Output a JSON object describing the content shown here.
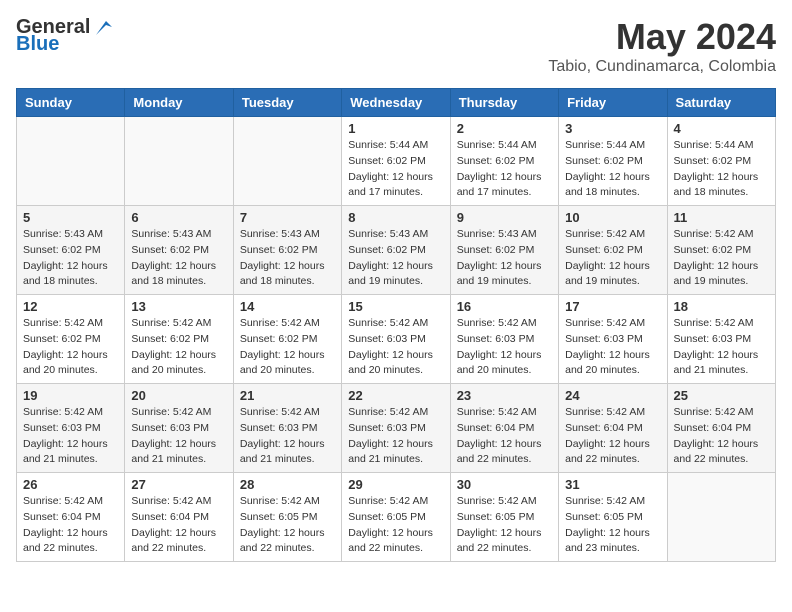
{
  "header": {
    "logo_general": "General",
    "logo_blue": "Blue",
    "month_year": "May 2024",
    "location": "Tabio, Cundinamarca, Colombia"
  },
  "days_of_week": [
    "Sunday",
    "Monday",
    "Tuesday",
    "Wednesday",
    "Thursday",
    "Friday",
    "Saturday"
  ],
  "weeks": [
    {
      "row_index": 0,
      "cells": [
        {
          "day": "",
          "info": ""
        },
        {
          "day": "",
          "info": ""
        },
        {
          "day": "",
          "info": ""
        },
        {
          "day": "1",
          "info": "Sunrise: 5:44 AM\nSunset: 6:02 PM\nDaylight: 12 hours\nand 17 minutes."
        },
        {
          "day": "2",
          "info": "Sunrise: 5:44 AM\nSunset: 6:02 PM\nDaylight: 12 hours\nand 17 minutes."
        },
        {
          "day": "3",
          "info": "Sunrise: 5:44 AM\nSunset: 6:02 PM\nDaylight: 12 hours\nand 18 minutes."
        },
        {
          "day": "4",
          "info": "Sunrise: 5:44 AM\nSunset: 6:02 PM\nDaylight: 12 hours\nand 18 minutes."
        }
      ]
    },
    {
      "row_index": 1,
      "cells": [
        {
          "day": "5",
          "info": "Sunrise: 5:43 AM\nSunset: 6:02 PM\nDaylight: 12 hours\nand 18 minutes."
        },
        {
          "day": "6",
          "info": "Sunrise: 5:43 AM\nSunset: 6:02 PM\nDaylight: 12 hours\nand 18 minutes."
        },
        {
          "day": "7",
          "info": "Sunrise: 5:43 AM\nSunset: 6:02 PM\nDaylight: 12 hours\nand 18 minutes."
        },
        {
          "day": "8",
          "info": "Sunrise: 5:43 AM\nSunset: 6:02 PM\nDaylight: 12 hours\nand 19 minutes."
        },
        {
          "day": "9",
          "info": "Sunrise: 5:43 AM\nSunset: 6:02 PM\nDaylight: 12 hours\nand 19 minutes."
        },
        {
          "day": "10",
          "info": "Sunrise: 5:42 AM\nSunset: 6:02 PM\nDaylight: 12 hours\nand 19 minutes."
        },
        {
          "day": "11",
          "info": "Sunrise: 5:42 AM\nSunset: 6:02 PM\nDaylight: 12 hours\nand 19 minutes."
        }
      ]
    },
    {
      "row_index": 2,
      "cells": [
        {
          "day": "12",
          "info": "Sunrise: 5:42 AM\nSunset: 6:02 PM\nDaylight: 12 hours\nand 20 minutes."
        },
        {
          "day": "13",
          "info": "Sunrise: 5:42 AM\nSunset: 6:02 PM\nDaylight: 12 hours\nand 20 minutes."
        },
        {
          "day": "14",
          "info": "Sunrise: 5:42 AM\nSunset: 6:02 PM\nDaylight: 12 hours\nand 20 minutes."
        },
        {
          "day": "15",
          "info": "Sunrise: 5:42 AM\nSunset: 6:03 PM\nDaylight: 12 hours\nand 20 minutes."
        },
        {
          "day": "16",
          "info": "Sunrise: 5:42 AM\nSunset: 6:03 PM\nDaylight: 12 hours\nand 20 minutes."
        },
        {
          "day": "17",
          "info": "Sunrise: 5:42 AM\nSunset: 6:03 PM\nDaylight: 12 hours\nand 20 minutes."
        },
        {
          "day": "18",
          "info": "Sunrise: 5:42 AM\nSunset: 6:03 PM\nDaylight: 12 hours\nand 21 minutes."
        }
      ]
    },
    {
      "row_index": 3,
      "cells": [
        {
          "day": "19",
          "info": "Sunrise: 5:42 AM\nSunset: 6:03 PM\nDaylight: 12 hours\nand 21 minutes."
        },
        {
          "day": "20",
          "info": "Sunrise: 5:42 AM\nSunset: 6:03 PM\nDaylight: 12 hours\nand 21 minutes."
        },
        {
          "day": "21",
          "info": "Sunrise: 5:42 AM\nSunset: 6:03 PM\nDaylight: 12 hours\nand 21 minutes."
        },
        {
          "day": "22",
          "info": "Sunrise: 5:42 AM\nSunset: 6:03 PM\nDaylight: 12 hours\nand 21 minutes."
        },
        {
          "day": "23",
          "info": "Sunrise: 5:42 AM\nSunset: 6:04 PM\nDaylight: 12 hours\nand 22 minutes."
        },
        {
          "day": "24",
          "info": "Sunrise: 5:42 AM\nSunset: 6:04 PM\nDaylight: 12 hours\nand 22 minutes."
        },
        {
          "day": "25",
          "info": "Sunrise: 5:42 AM\nSunset: 6:04 PM\nDaylight: 12 hours\nand 22 minutes."
        }
      ]
    },
    {
      "row_index": 4,
      "cells": [
        {
          "day": "26",
          "info": "Sunrise: 5:42 AM\nSunset: 6:04 PM\nDaylight: 12 hours\nand 22 minutes."
        },
        {
          "day": "27",
          "info": "Sunrise: 5:42 AM\nSunset: 6:04 PM\nDaylight: 12 hours\nand 22 minutes."
        },
        {
          "day": "28",
          "info": "Sunrise: 5:42 AM\nSunset: 6:05 PM\nDaylight: 12 hours\nand 22 minutes."
        },
        {
          "day": "29",
          "info": "Sunrise: 5:42 AM\nSunset: 6:05 PM\nDaylight: 12 hours\nand 22 minutes."
        },
        {
          "day": "30",
          "info": "Sunrise: 5:42 AM\nSunset: 6:05 PM\nDaylight: 12 hours\nand 22 minutes."
        },
        {
          "day": "31",
          "info": "Sunrise: 5:42 AM\nSunset: 6:05 PM\nDaylight: 12 hours\nand 23 minutes."
        },
        {
          "day": "",
          "info": ""
        }
      ]
    }
  ]
}
